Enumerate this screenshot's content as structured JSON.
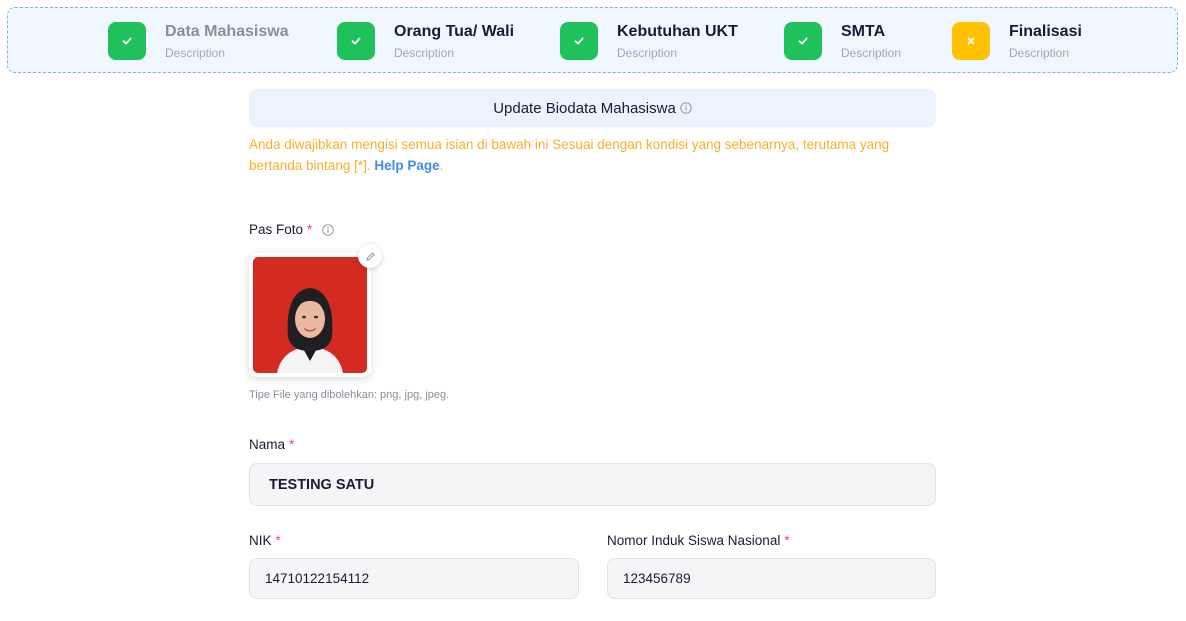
{
  "stepper": {
    "steps": [
      {
        "title": "Data Mahasiswa",
        "description": "Description",
        "status": "done"
      },
      {
        "title": "Orang Tua/ Wali",
        "description": "Description",
        "status": "done"
      },
      {
        "title": "Kebutuhan UKT",
        "description": "Description",
        "status": "done"
      },
      {
        "title": "SMTA",
        "description": "Description",
        "status": "done"
      },
      {
        "title": "Finalisasi",
        "description": "Description",
        "status": "pending"
      }
    ]
  },
  "header": {
    "title": "Update Biodata Mahasiswa"
  },
  "notice": {
    "text": "Anda diwajibkan mengisi semua isian di bawah ini Sesuai dengan kondisi yang sebenarnya, terutama yang bertanda bintang [*]. ",
    "link": "Help Page",
    "end": "."
  },
  "form": {
    "required_mark": "*",
    "photo": {
      "label": "Pas Foto",
      "hint": "Tipe File yang dibolehkan: png, jpg, jpeg."
    },
    "nama": {
      "label": "Nama",
      "value": "TESTING SATU"
    },
    "nik": {
      "label": "NIK",
      "value": "14710122154112"
    },
    "nisn": {
      "label": "Nomor Induk Siswa Nasional",
      "value": "123456789"
    }
  },
  "icons": {
    "done": "check-icon",
    "pending": "close-icon",
    "info": "info-icon",
    "edit": "pencil-icon"
  },
  "colors": {
    "success": "#1fc15a",
    "warning": "#ffc102",
    "notice_text": "#f6b02a",
    "link": "#3e8cf1",
    "required": "#f1416c",
    "photo_bg": "#d32a22"
  }
}
